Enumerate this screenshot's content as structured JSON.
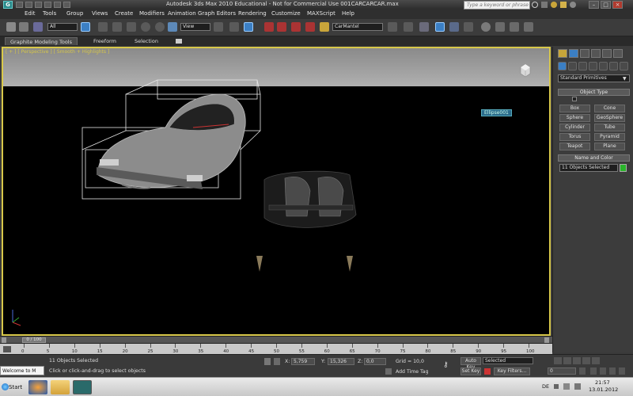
{
  "window": {
    "title": "Autodesk 3ds Max  2010   Educational - Not for Commercial Use    001CARCARCAR.max",
    "search_placeholder": "Type a keyword or phrase",
    "minimize": "–",
    "maximize": "□",
    "close": "×"
  },
  "menu": [
    "Edit",
    "Tools",
    "Group",
    "Views",
    "Create",
    "Modifiers",
    "Animation",
    "Graph Editors",
    "Rendering",
    "Customize",
    "MAXScript",
    "Help"
  ],
  "toolbar": {
    "selection_filter": "All",
    "reference_coord": "View",
    "named_selection": "CarMantel"
  },
  "ribbon": {
    "tabs": [
      "Graphite Modeling Tools",
      "Freeform",
      "Selection"
    ]
  },
  "viewport": {
    "label": "[ + ] [ Perspective ] [ Smooth + Highlights ]",
    "object_tag": "Ellipse001"
  },
  "command_panel": {
    "category": "Standard Primitives",
    "object_type_header": "Object Type",
    "primitives": [
      "Box",
      "Cone",
      "Sphere",
      "GeoSphere",
      "Cylinder",
      "Tube",
      "Torus",
      "Pyramid",
      "Teapot",
      "Plane"
    ],
    "name_color_header": "Name and Color",
    "name_value": "11 Objects Selected",
    "swatch_color": "#29b42a"
  },
  "timeline": {
    "frame_display": "0 / 100",
    "ticks": [
      "0",
      "5",
      "10",
      "15",
      "20",
      "25",
      "30",
      "35",
      "40",
      "45",
      "50",
      "55",
      "60",
      "65",
      "70",
      "75",
      "80",
      "85",
      "90",
      "95",
      "100"
    ]
  },
  "status": {
    "maxscript": "Welcome to M",
    "selection_info": "11 Objects Selected",
    "prompt": "Click or click-and-drag to select objects",
    "x_label": "X:",
    "x_value": "5,759",
    "y_label": "Y:",
    "y_value": "15,326",
    "z_label": "Z:",
    "z_value": "0,0",
    "grid": "Grid = 10,0",
    "add_time_tag": "Add Time Tag",
    "auto_key": "Auto Key",
    "auto_key_mode": "Selected",
    "set_key": "Set Key",
    "key_filters": "Key Filters...",
    "frame_field": "0"
  },
  "taskbar": {
    "start": "Start",
    "language": "DE",
    "time": "21:57",
    "date": "13.01.2012"
  }
}
